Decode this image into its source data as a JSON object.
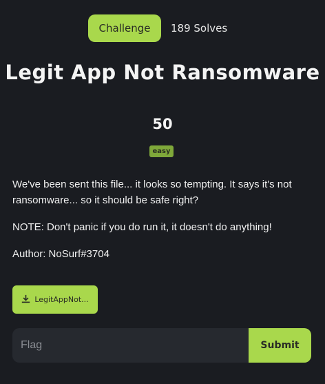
{
  "header": {
    "tab_label": "Challenge",
    "solves": "189 Solves"
  },
  "challenge": {
    "title": "Legit App Not Ransomware",
    "points": "50",
    "difficulty": "easy",
    "description": [
      "We've been sent this file... it looks so tempting. It says it's not ransomware... so it should be safe right?",
      "NOTE: Don't panic if you do run it, it doesn't do anything!",
      "Author: NoSurf#3704"
    ],
    "file_label": "LegitAppNot..."
  },
  "flag_form": {
    "placeholder": "Flag",
    "submit_label": "Submit"
  },
  "colors": {
    "background": "#1a1c21",
    "accent": "#a9d84c",
    "difficulty_badge": "#7fa83a",
    "input_bg": "#26292f"
  },
  "icons": {
    "download": "download-icon"
  }
}
